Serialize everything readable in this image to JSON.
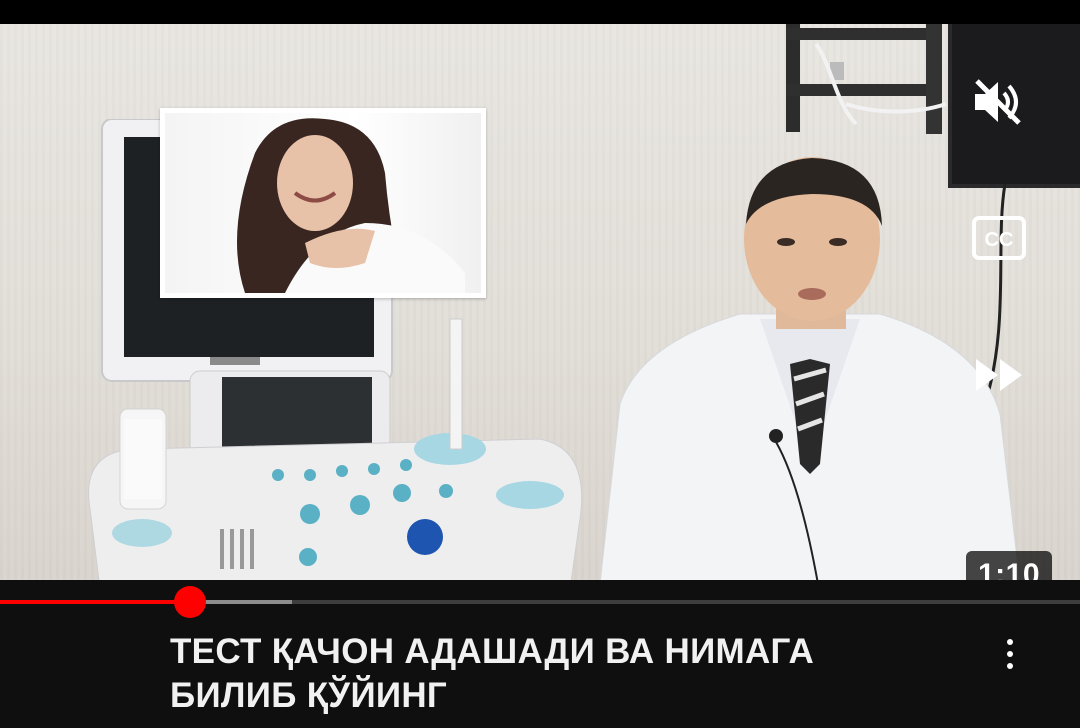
{
  "player": {
    "duration_label": "1:10",
    "progress_fraction": 0.176,
    "buffered_fraction": 0.27,
    "mute_icon": "volume-muted-icon",
    "cc_icon": "closed-captions-icon",
    "cc_label": "CC",
    "skip_icon": "fast-forward-icon",
    "accent_color": "#ff0000"
  },
  "video": {
    "title": "ТЕСТ ҚАЧОН АДАШАДИ ВА НИМАГА БИЛИБ ҚЎЙИНГ"
  },
  "menu": {
    "icon": "more-vertical-icon"
  }
}
